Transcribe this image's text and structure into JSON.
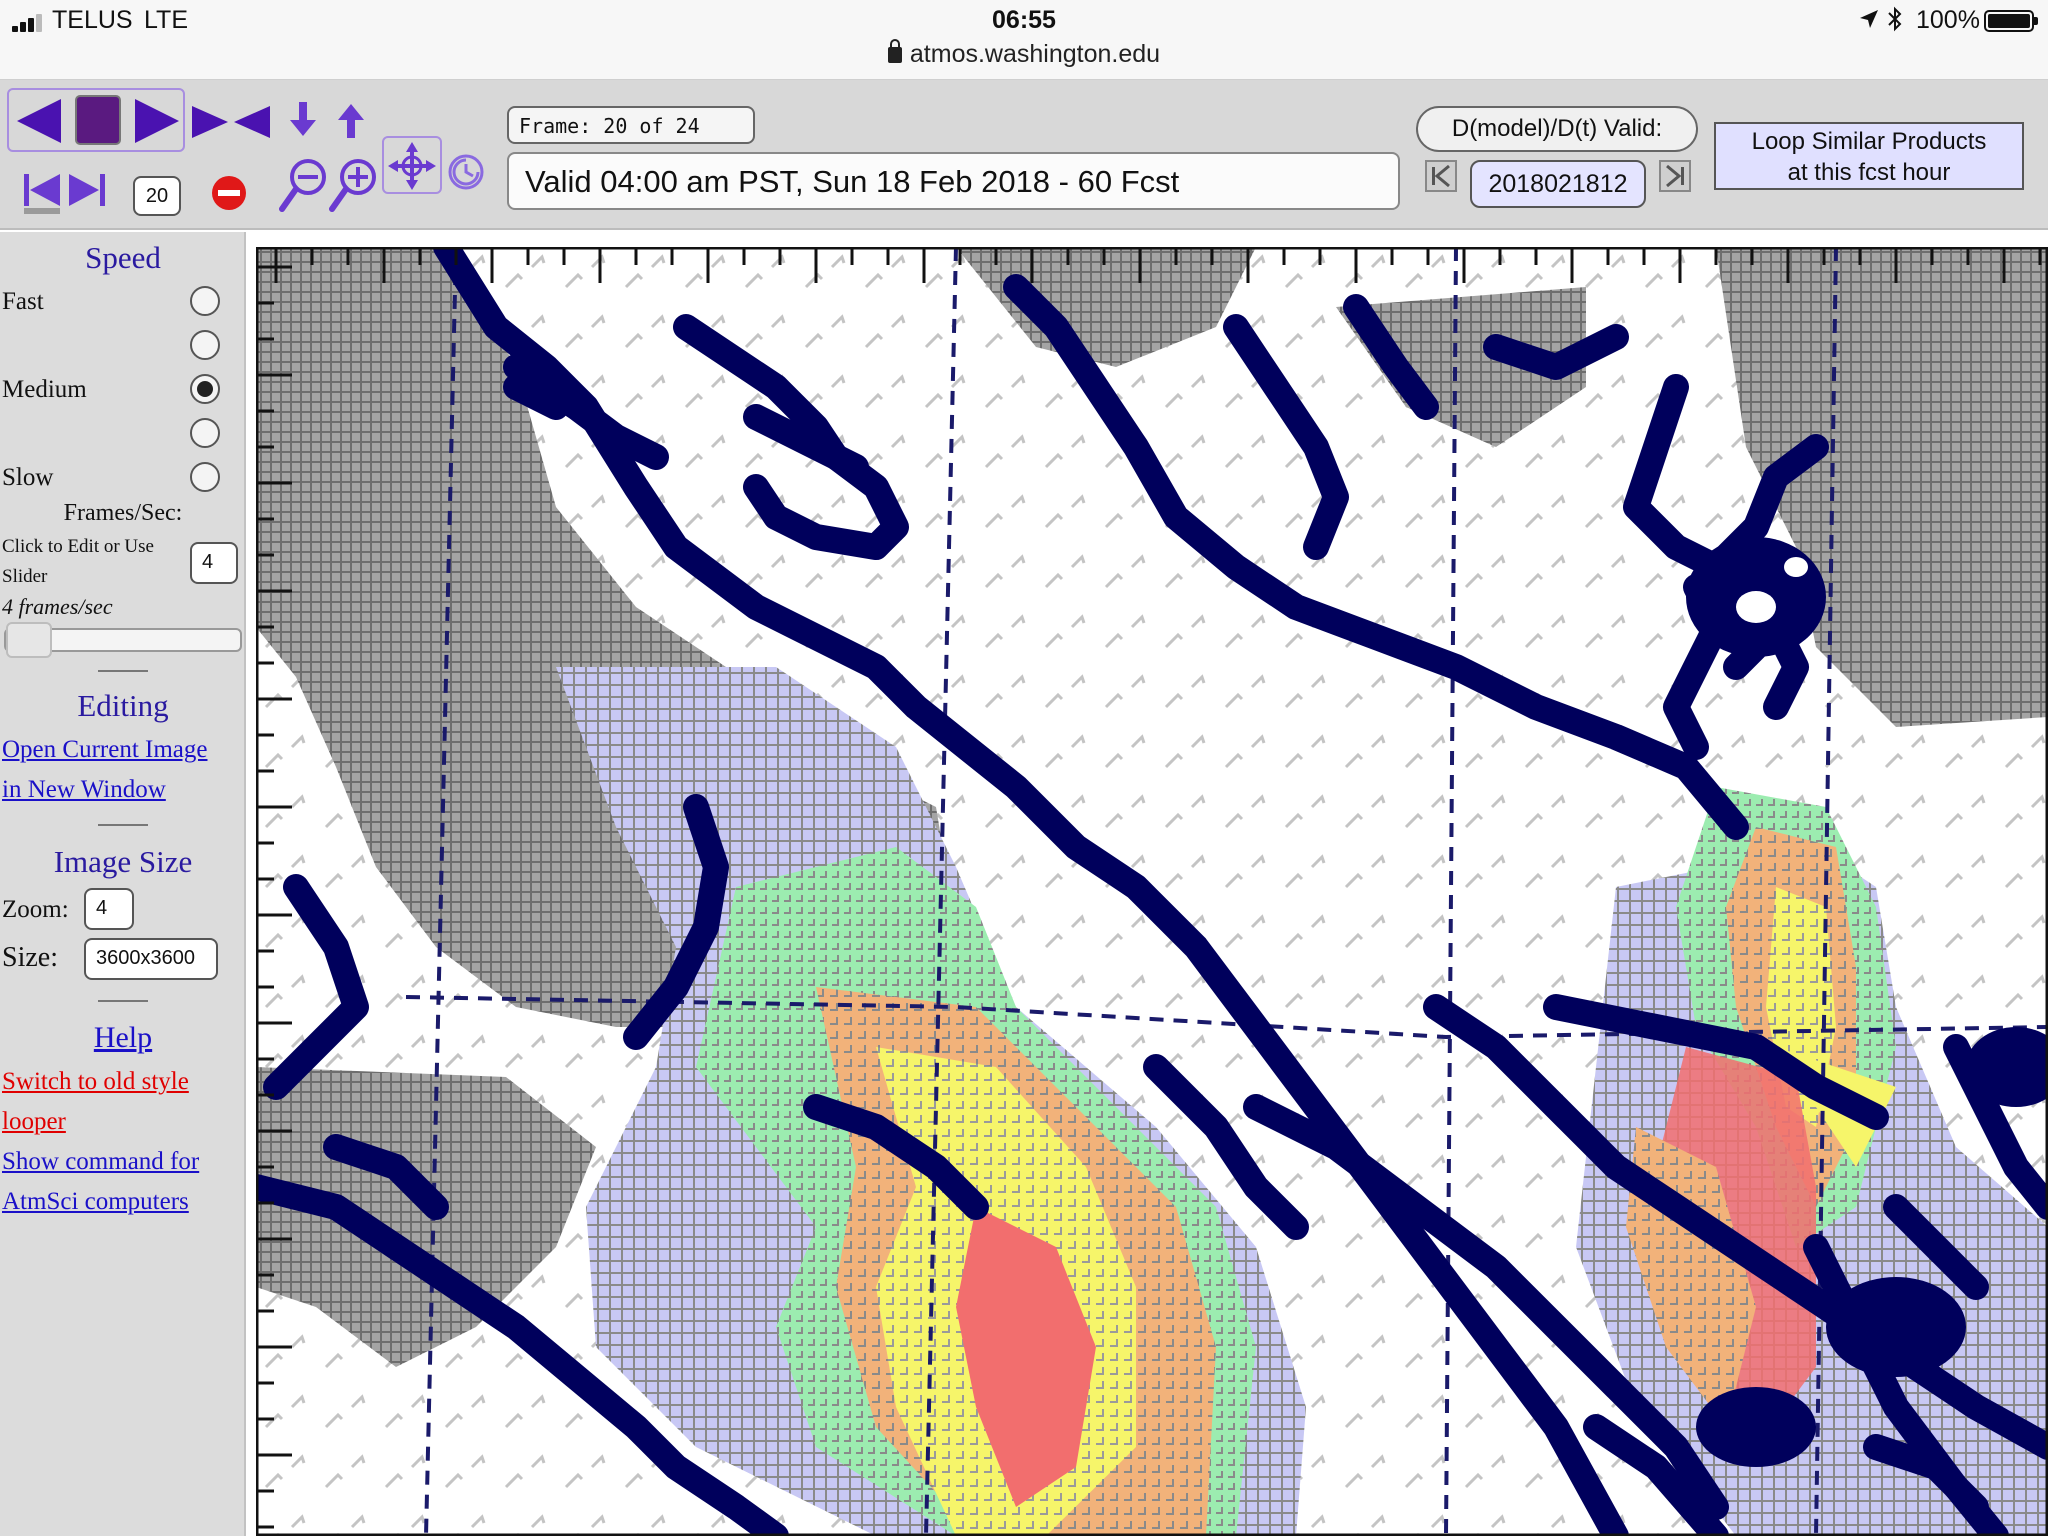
{
  "status_bar": {
    "carrier": "TELUS",
    "network": "LTE",
    "time": "06:55",
    "battery": "100%",
    "battery_level": 1.0,
    "url": "atmos.washington.edu"
  },
  "toolbar": {
    "frame_counter": "Frame: 20 of 24",
    "valid_time": "Valid 04:00 am PST, Sun 18 Feb 2018 - 60 Fcst",
    "dmodel_button": "D(model)/D(t) Valid:",
    "date_value": "2018021812",
    "loop_similar_line1": "Loop Similar Products",
    "loop_similar_line2": "at this fcst hour",
    "frame_number": "20",
    "accent_color": "#4a12b0",
    "icons": [
      "play-backward-icon",
      "stop-icon",
      "play-forward-icon",
      "rock-icon",
      "step-down-icon",
      "step-up-icon",
      "first-frame-icon",
      "last-frame-icon",
      "no-entry-icon",
      "zoom-out-icon",
      "zoom-in-icon",
      "pan-icon",
      "reset-icon",
      "prev-date-icon",
      "next-date-icon"
    ]
  },
  "sidebar": {
    "speed_heading": "Speed",
    "speed_options": [
      {
        "label": "Fast",
        "checked": false
      },
      {
        "label": "",
        "checked": false
      },
      {
        "label": "Medium",
        "checked": true
      },
      {
        "label": "",
        "checked": false
      },
      {
        "label": "Slow",
        "checked": false
      }
    ],
    "frames_heading": "Frames/Sec:",
    "frames_hint_line1": "Click to Edit or Use",
    "frames_hint_line2": "Slider",
    "frames_value": "4",
    "frames_readout": "4 frames/sec",
    "editing_heading": "Editing",
    "open_image_line1": "Open Current Image",
    "open_image_line2": "in New Window",
    "image_size_heading": "Image Size",
    "zoom_label": "Zoom:",
    "zoom_value": "4",
    "size_label": "Size:",
    "size_value": "3600x3600",
    "help_link": "Help",
    "old_style_line1": "Switch to old style",
    "old_style_line2": "looper",
    "command_line1": "Show command for",
    "command_line2": "AtmSci computers"
  },
  "map": {
    "colors": {
      "coast": "#00005c",
      "terrain": "#8a8a8a",
      "light_blue": "#c8c8f4",
      "green": "#9cecb0",
      "orange": "#f2b27a",
      "yellow": "#f6f56a",
      "red": "#f26e6e",
      "grid": "#1a1a6a"
    }
  }
}
